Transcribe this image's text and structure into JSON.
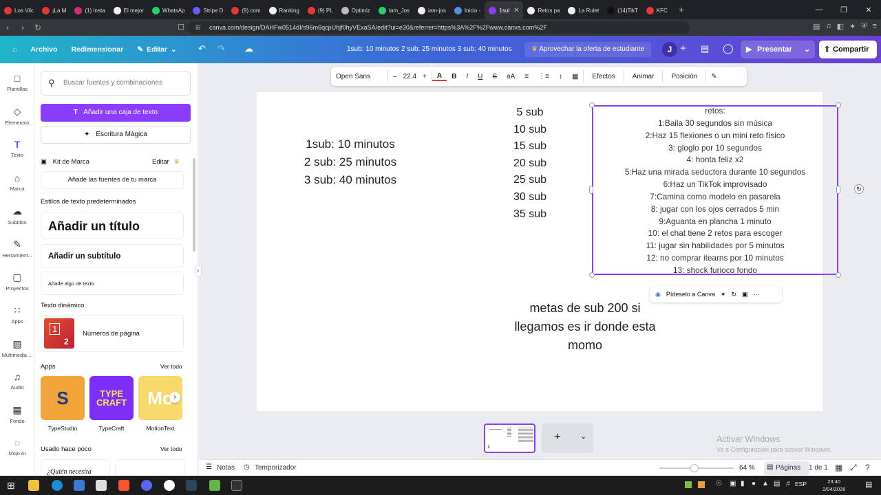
{
  "browser": {
    "tabs": [
      {
        "label": "Los Vilc",
        "color": "#e53935"
      },
      {
        "label": "¡La M",
        "color": "#e53935"
      },
      {
        "label": "(1) Insta",
        "color": "#d62976"
      },
      {
        "label": "El mejor",
        "color": "#eeeeee"
      },
      {
        "label": "WhatsAp",
        "color": "#25d366"
      },
      {
        "label": "Stripe D",
        "color": "#635bff"
      },
      {
        "label": "(9) com",
        "color": "#e53935"
      },
      {
        "label": "Ranking",
        "color": "#eeeeee"
      },
      {
        "label": "(9) PL",
        "color": "#e53935"
      },
      {
        "label": "Optimiz",
        "color": "#bbbbbb"
      },
      {
        "label": "Iam_Jos",
        "color": "#2ecc71"
      },
      {
        "label": "iam-jos",
        "color": "#eeeeee"
      },
      {
        "label": "Inicio -",
        "color": "#4a90e2"
      },
      {
        "label": "1sul",
        "color": "#8b3dff"
      },
      {
        "label": "Retos pa",
        "color": "#eeeeee"
      },
      {
        "label": "La Rulet",
        "color": "#eeeeee"
      },
      {
        "label": "(14)TikT",
        "color": "#111111"
      },
      {
        "label": "KFC",
        "color": "#e53935"
      }
    ],
    "active_tab_index": 13,
    "new_tab_label": "+",
    "window_controls": [
      "—",
      "❒",
      "✕"
    ],
    "url": "canva.com/design/DAHFw0514dI/s96m6qcpUhjf0hyVExaSA/edit?ui=e30&referrer=https%3A%2F%2Fwww.canva.com%2F"
  },
  "header": {
    "file_label": "Archivo",
    "resize_label": "Redimensionar",
    "edit_label": "Editar",
    "doc_title": "1sub: 10 minutos 2 sub: 25 minutos 3 sub: 40 minutos",
    "promo_label": "Aprovechar la oferta de estudiante",
    "avatar_letter": "J",
    "present_label": "Presentar",
    "share_label": "Compartir"
  },
  "rail": [
    {
      "label": "Plantillas",
      "icon": "□"
    },
    {
      "label": "Elementos",
      "icon": "◇"
    },
    {
      "label": "Texto",
      "icon": "T"
    },
    {
      "label": "Marca",
      "icon": "⌂"
    },
    {
      "label": "Subidos",
      "icon": "☁"
    },
    {
      "label": "Herramient...",
      "icon": "✎"
    },
    {
      "label": "Proyectos",
      "icon": "▢"
    },
    {
      "label": "Apps",
      "icon": "∷"
    },
    {
      "label": "Multimedia ...",
      "icon": "▧"
    },
    {
      "label": "Audio",
      "icon": "♫"
    },
    {
      "label": "Fondo",
      "icon": "▦"
    },
    {
      "label": "Mojo AI",
      "icon": "◌"
    }
  ],
  "panel": {
    "search_placeholder": "Buscar fuentes y combinaciones",
    "add_text_box": "Añadir una caja de texto",
    "magic_write": "Escritura Mágica",
    "brand_kit": "Kit de Marca",
    "brand_edit": "Editar",
    "brand_fonts": "Añade las fuentes de tu marca",
    "default_styles": "Estilos de texto predeterminados",
    "add_title": "Añadir un título",
    "add_subtitle": "Añadir un subtítulo",
    "add_body": "Añade algo de texto",
    "dynamic_text": "Texto dinámico",
    "page_numbers": "Números de página",
    "page_number_thumb": "2",
    "apps_heading": "Apps",
    "see_all": "Ver todo",
    "apps": [
      {
        "label": "TypeStudio",
        "color": "#f2a33a",
        "thumb": "S"
      },
      {
        "label": "TypeCraft",
        "color": "#7b2ff7",
        "thumb": "TYPE CRAFT"
      },
      {
        "label": "MotionText",
        "color": "#f7d86a",
        "thumb": "Mo"
      }
    ],
    "recent_heading": "Usado hace poco",
    "recent_see_all": "Ver todo",
    "recent_snippet": "¿Quién necesita"
  },
  "toolbar": {
    "font": "Open Sans",
    "font_size": "22.4",
    "minus": "–",
    "plus": "+",
    "bold": "B",
    "italic": "I",
    "underline": "U",
    "strike": "S",
    "case": "aA",
    "effects": "Efectos",
    "animate": "Animar",
    "position": "Posición"
  },
  "canvas": {
    "schedule": [
      "1sub: 10 minutos",
      "2 sub: 25 minutos",
      "3 sub: 40 minutos"
    ],
    "subs": [
      "5 sub",
      "10 sub",
      "15 sub",
      "20 sub",
      "25 sub",
      "30 sub",
      "35 sub"
    ],
    "retos": [
      "retos:",
      "1:Baila 30 segundos sin música",
      "2:Haz 15 flexiones o un mini reto físico",
      "3: gloglo por 10 segundos",
      "4: honta feliz x2",
      "5:Haz una mirada seductora durante 10 segundos",
      "6:Haz un TikTok improvisado",
      "7:Camina como modelo en pasarela",
      "8: jugar con los ojos cerrados 5 min",
      "9:Aguanta en plancha 1 minuto",
      "10: el chat tiene 2 retos para escoger",
      "11: jugar sin habilidades por 5 minutos",
      "12: no comprar itearns por 10 minutos",
      "13: shock furioco fondo"
    ],
    "ask_canva": "Pídeselo a Canva",
    "metas": [
      "metas de sub 200 si",
      "llegamos es ir donde esta",
      "momo"
    ]
  },
  "footer": {
    "notes": "Notas",
    "timer": "Temporizador",
    "zoom": "64 %",
    "pages": "Páginas",
    "page_count": "1 de 1",
    "thumb_page_number": "1",
    "add_page": "+",
    "watermark_title": "Activar Windows",
    "watermark_sub": "Ve a Configuración para activar Windows."
  },
  "taskbar": {
    "language": "ESP",
    "time": "23:40",
    "date": "2/04/2026"
  }
}
